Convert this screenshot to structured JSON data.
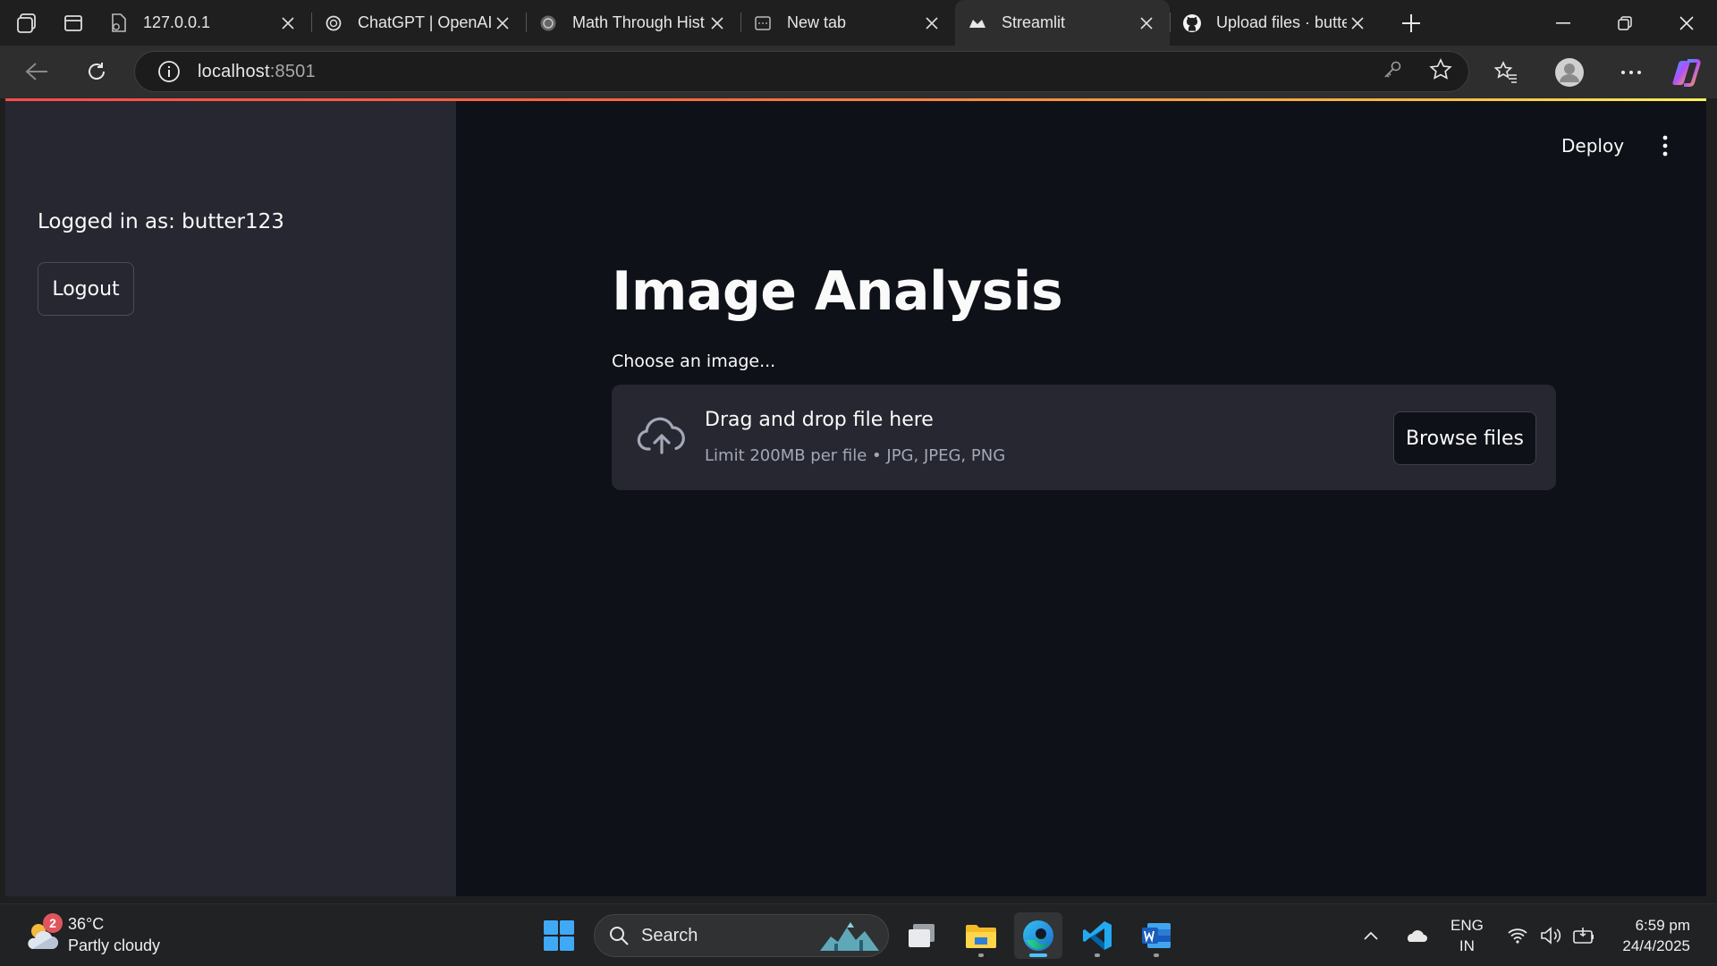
{
  "browser": {
    "tabs": [
      {
        "title": "127.0.0.1",
        "icon": "file-icon"
      },
      {
        "title": "ChatGPT | OpenAI",
        "icon": "openai-icon"
      },
      {
        "title": "Math Through Hist",
        "icon": "openai-icon"
      },
      {
        "title": "New tab",
        "icon": "newtab-icon"
      },
      {
        "title": "Streamlit",
        "icon": "streamlit-icon"
      },
      {
        "title": "Upload files · butte",
        "icon": "github-icon"
      }
    ],
    "active_tab_index": 4,
    "url_host": "localhost",
    "url_port": ":8501"
  },
  "sidebar": {
    "logged_in_text": "Logged in as: butter123",
    "logout_label": "Logout"
  },
  "header": {
    "deploy_label": "Deploy"
  },
  "main": {
    "title": "Image Analysis",
    "uploader_label": "Choose an image...",
    "dropzone_title": "Drag and drop file here",
    "dropzone_limits": "Limit 200MB per file • JPG, JPEG, PNG",
    "browse_label": "Browse files"
  },
  "taskbar": {
    "weather_temp": "36°C",
    "weather_desc": "Partly cloudy",
    "weather_badge": "2",
    "search_label": "Search",
    "lang_line1": "ENG",
    "lang_line2": "IN",
    "time": "6:59 pm",
    "date": "24/4/2025"
  },
  "colors": {
    "app_bg": "#0e1117",
    "sidebar_bg": "#262730",
    "accent_start": "#ff4b4b",
    "accent_end": "#fff35a"
  }
}
